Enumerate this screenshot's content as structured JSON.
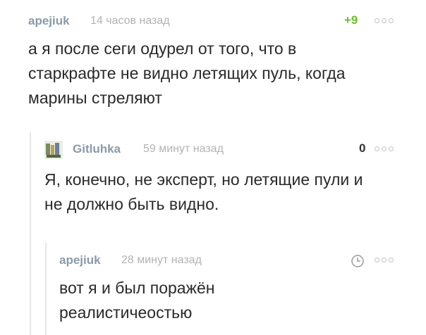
{
  "comments": [
    {
      "author": "apejiuk",
      "time": "14 часов назад",
      "rating": "+9",
      "text": "а я после сеги одурел от того, что в старкрафте не видно летящих пуль, когда марины стреляют"
    },
    {
      "author": "Gitluhka",
      "time": "59 минут назад",
      "rating": "0",
      "text": "Я, конечно, не эксперт, но летящие пули и не должно быть видно."
    },
    {
      "author": "apejiuk",
      "time": "28 минут назад",
      "text": "вот я и был поражён реалистичеостью"
    }
  ],
  "icons": {
    "more": "more-dots-icon",
    "clock": "clock-icon",
    "avatar": "user-avatar"
  },
  "colors": {
    "author": "#8a9aa8",
    "positive_rating": "#6cbe2c",
    "timestamp": "#b3b3b3",
    "thread_line": "#e6e6e6"
  }
}
